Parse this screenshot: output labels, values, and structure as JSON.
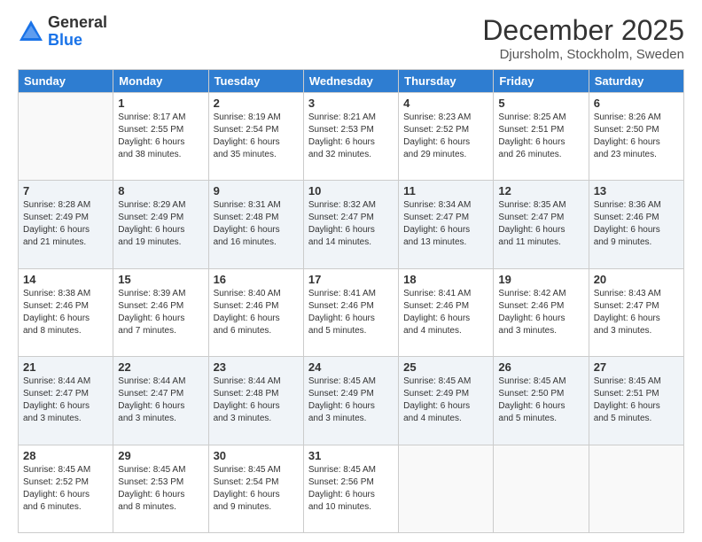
{
  "logo": {
    "general": "General",
    "blue": "Blue"
  },
  "header": {
    "title": "December 2025",
    "subtitle": "Djursholm, Stockholm, Sweden"
  },
  "weekdays": [
    "Sunday",
    "Monday",
    "Tuesday",
    "Wednesday",
    "Thursday",
    "Friday",
    "Saturday"
  ],
  "weeks": [
    [
      {
        "day": "",
        "info": ""
      },
      {
        "day": "1",
        "info": "Sunrise: 8:17 AM\nSunset: 2:55 PM\nDaylight: 6 hours\nand 38 minutes."
      },
      {
        "day": "2",
        "info": "Sunrise: 8:19 AM\nSunset: 2:54 PM\nDaylight: 6 hours\nand 35 minutes."
      },
      {
        "day": "3",
        "info": "Sunrise: 8:21 AM\nSunset: 2:53 PM\nDaylight: 6 hours\nand 32 minutes."
      },
      {
        "day": "4",
        "info": "Sunrise: 8:23 AM\nSunset: 2:52 PM\nDaylight: 6 hours\nand 29 minutes."
      },
      {
        "day": "5",
        "info": "Sunrise: 8:25 AM\nSunset: 2:51 PM\nDaylight: 6 hours\nand 26 minutes."
      },
      {
        "day": "6",
        "info": "Sunrise: 8:26 AM\nSunset: 2:50 PM\nDaylight: 6 hours\nand 23 minutes."
      }
    ],
    [
      {
        "day": "7",
        "info": "Sunrise: 8:28 AM\nSunset: 2:49 PM\nDaylight: 6 hours\nand 21 minutes."
      },
      {
        "day": "8",
        "info": "Sunrise: 8:29 AM\nSunset: 2:49 PM\nDaylight: 6 hours\nand 19 minutes."
      },
      {
        "day": "9",
        "info": "Sunrise: 8:31 AM\nSunset: 2:48 PM\nDaylight: 6 hours\nand 16 minutes."
      },
      {
        "day": "10",
        "info": "Sunrise: 8:32 AM\nSunset: 2:47 PM\nDaylight: 6 hours\nand 14 minutes."
      },
      {
        "day": "11",
        "info": "Sunrise: 8:34 AM\nSunset: 2:47 PM\nDaylight: 6 hours\nand 13 minutes."
      },
      {
        "day": "12",
        "info": "Sunrise: 8:35 AM\nSunset: 2:47 PM\nDaylight: 6 hours\nand 11 minutes."
      },
      {
        "day": "13",
        "info": "Sunrise: 8:36 AM\nSunset: 2:46 PM\nDaylight: 6 hours\nand 9 minutes."
      }
    ],
    [
      {
        "day": "14",
        "info": "Sunrise: 8:38 AM\nSunset: 2:46 PM\nDaylight: 6 hours\nand 8 minutes."
      },
      {
        "day": "15",
        "info": "Sunrise: 8:39 AM\nSunset: 2:46 PM\nDaylight: 6 hours\nand 7 minutes."
      },
      {
        "day": "16",
        "info": "Sunrise: 8:40 AM\nSunset: 2:46 PM\nDaylight: 6 hours\nand 6 minutes."
      },
      {
        "day": "17",
        "info": "Sunrise: 8:41 AM\nSunset: 2:46 PM\nDaylight: 6 hours\nand 5 minutes."
      },
      {
        "day": "18",
        "info": "Sunrise: 8:41 AM\nSunset: 2:46 PM\nDaylight: 6 hours\nand 4 minutes."
      },
      {
        "day": "19",
        "info": "Sunrise: 8:42 AM\nSunset: 2:46 PM\nDaylight: 6 hours\nand 3 minutes."
      },
      {
        "day": "20",
        "info": "Sunrise: 8:43 AM\nSunset: 2:47 PM\nDaylight: 6 hours\nand 3 minutes."
      }
    ],
    [
      {
        "day": "21",
        "info": "Sunrise: 8:44 AM\nSunset: 2:47 PM\nDaylight: 6 hours\nand 3 minutes."
      },
      {
        "day": "22",
        "info": "Sunrise: 8:44 AM\nSunset: 2:47 PM\nDaylight: 6 hours\nand 3 minutes."
      },
      {
        "day": "23",
        "info": "Sunrise: 8:44 AM\nSunset: 2:48 PM\nDaylight: 6 hours\nand 3 minutes."
      },
      {
        "day": "24",
        "info": "Sunrise: 8:45 AM\nSunset: 2:49 PM\nDaylight: 6 hours\nand 3 minutes."
      },
      {
        "day": "25",
        "info": "Sunrise: 8:45 AM\nSunset: 2:49 PM\nDaylight: 6 hours\nand 4 minutes."
      },
      {
        "day": "26",
        "info": "Sunrise: 8:45 AM\nSunset: 2:50 PM\nDaylight: 6 hours\nand 5 minutes."
      },
      {
        "day": "27",
        "info": "Sunrise: 8:45 AM\nSunset: 2:51 PM\nDaylight: 6 hours\nand 5 minutes."
      }
    ],
    [
      {
        "day": "28",
        "info": "Sunrise: 8:45 AM\nSunset: 2:52 PM\nDaylight: 6 hours\nand 6 minutes."
      },
      {
        "day": "29",
        "info": "Sunrise: 8:45 AM\nSunset: 2:53 PM\nDaylight: 6 hours\nand 8 minutes."
      },
      {
        "day": "30",
        "info": "Sunrise: 8:45 AM\nSunset: 2:54 PM\nDaylight: 6 hours\nand 9 minutes."
      },
      {
        "day": "31",
        "info": "Sunrise: 8:45 AM\nSunset: 2:56 PM\nDaylight: 6 hours\nand 10 minutes."
      },
      {
        "day": "",
        "info": ""
      },
      {
        "day": "",
        "info": ""
      },
      {
        "day": "",
        "info": ""
      }
    ]
  ]
}
